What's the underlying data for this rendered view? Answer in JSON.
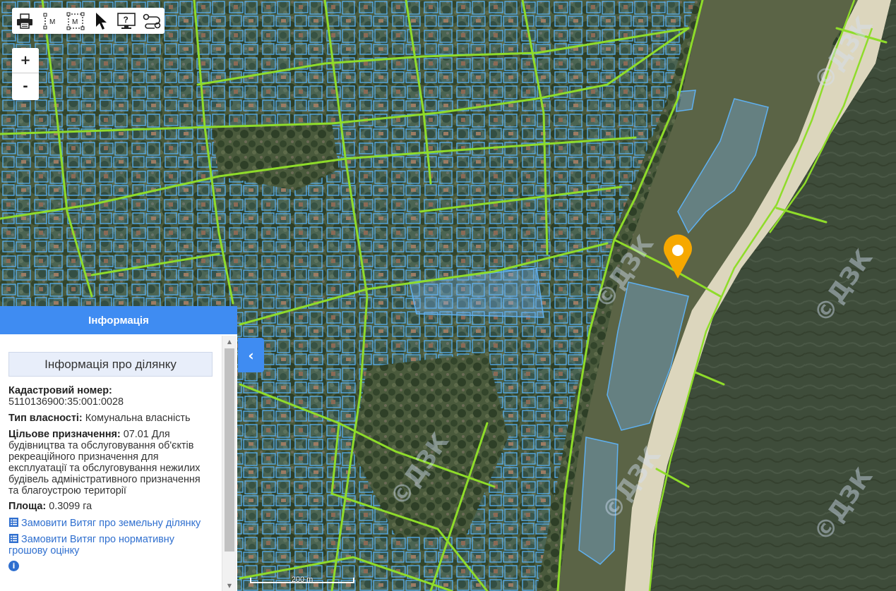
{
  "toolbar": {
    "print_label": "print",
    "measure_line_label": "M",
    "measure_area_label": "M",
    "pointer_label": "select",
    "help_label": "?",
    "route_label": "route"
  },
  "zoom": {
    "in_label": "+",
    "out_label": "-"
  },
  "panel": {
    "header": "Інформація",
    "section_title": "Інформація про ділянку",
    "cadastral_label": "Кадастровий номер:",
    "cadastral_value": "5110136900:35:001:0028",
    "ownership_label": "Тип власності:",
    "ownership_value": "Комунальна власність",
    "purpose_label": "Цільове призначення:",
    "purpose_value": "07.01 Для будівництва та обслуговування об'єктів рекреаційного призначення для експлуатації та обслуговування нежилих будівель адміністративного призначення та благоустрою території",
    "area_label": "Площа:",
    "area_value": "0.3099 га",
    "link_extract": "Замовити Витяг про земельну ділянку",
    "link_valuation": "Замовити Витяг про нормативну грошову оцінку",
    "next_item_partial": ""
  },
  "map": {
    "scale_label": "200 m",
    "watermark": "©ДЗК",
    "colors": {
      "parcel": "#4fa9ee",
      "road": "#8fdc2a",
      "marker": "#f6a800",
      "sea": "#3c4b38",
      "beach": "#ddd9c4",
      "urban": "#55604a"
    }
  },
  "icons": [
    "printer-icon",
    "measure-line-icon",
    "measure-area-icon",
    "pointer-icon",
    "help-monitor-icon",
    "route-icon",
    "document-icon",
    "chevron-left-icon",
    "location-pin-icon"
  ]
}
